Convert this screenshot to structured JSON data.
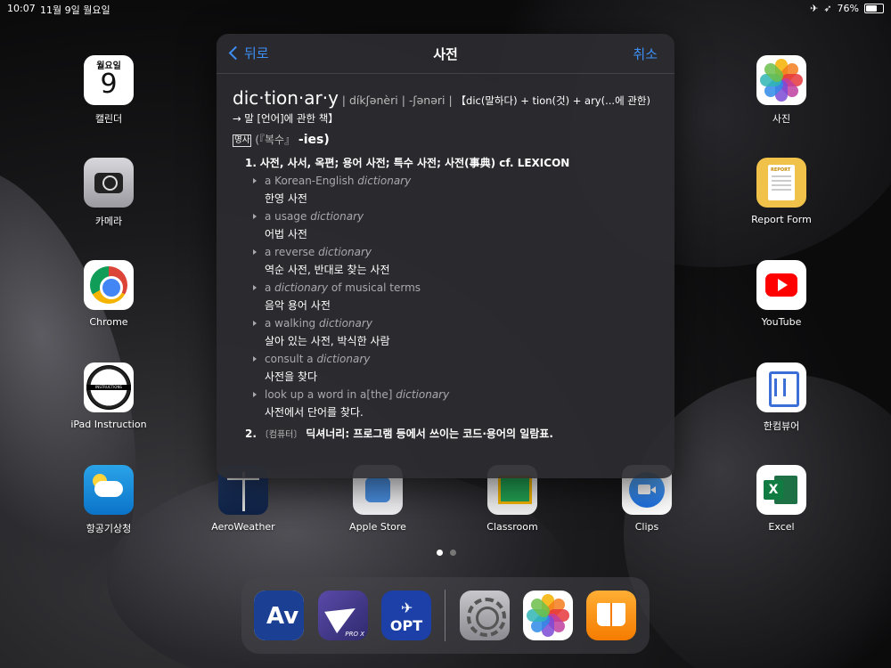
{
  "status_bar": {
    "time": "10:07",
    "date": "11월 9일 월요일",
    "battery": "76%",
    "battery_level": 0.76,
    "icons": [
      "airplane-icon",
      "location-icon"
    ]
  },
  "apps": {
    "calendar": {
      "label": "캘린더",
      "weekday": "월요일",
      "day": "9"
    },
    "camera": {
      "label": "카메라"
    },
    "chrome": {
      "label": "Chrome"
    },
    "ipad_instruction": {
      "label": "iPad Instruction",
      "logo_text": "INSTRUCTIONS"
    },
    "weather": {
      "label": "항공기상청"
    },
    "aeroweather": {
      "label": "AeroWeather"
    },
    "apple_store": {
      "label": "Apple Store"
    },
    "classroom": {
      "label": "Classroom"
    },
    "clips": {
      "label": "Clips"
    },
    "photos": {
      "label": "사진"
    },
    "report_form": {
      "label": "Report Form",
      "logo_text": "REPORT"
    },
    "youtube": {
      "label": "YouTube"
    },
    "hancom": {
      "label": "한컴뷰어"
    },
    "excel": {
      "label": "Excel",
      "logo_text": "X"
    }
  },
  "page_dots": {
    "count": 2,
    "active": 0
  },
  "dock": {
    "items": [
      {
        "name": "av-app",
        "text": "Av"
      },
      {
        "name": "flight-app",
        "text": "PRO X"
      },
      {
        "name": "opt-app",
        "text": "OPT"
      },
      {
        "name": "settings-app",
        "text": ""
      },
      {
        "name": "photos-app",
        "text": ""
      },
      {
        "name": "books-app",
        "text": ""
      }
    ]
  },
  "dictionary": {
    "back_label": "뒤로",
    "title": "사전",
    "cancel_label": "취소",
    "headword": "dic·tion·ar·y",
    "pronunciation": "| díkʃənèri | -ʃənəri |",
    "etymology": "【dic(말하다) + tion(것) + ary(...에 관한) → 말 [언어]에 관한 책】",
    "pos": "명사",
    "plural_prefix": "(『복수』",
    "plural_suffix": "-ies)",
    "senses": [
      {
        "num": "1.",
        "definition": "사전, 사서, 옥편; 용어 사전; 특수 사전; 사전(事典) cf. LEXICON",
        "examples": [
          {
            "pre": "a Korean-English ",
            "em": "dictionary",
            "post": "",
            "trans": "한영 사전"
          },
          {
            "pre": "a usage ",
            "em": "dictionary",
            "post": "",
            "trans": "어법 사전"
          },
          {
            "pre": "a reverse ",
            "em": "dictionary",
            "post": "",
            "trans": "역순 사전, 반대로 찾는 사전"
          },
          {
            "pre": "a ",
            "em": "dictionary",
            "post": " of musical terms",
            "trans": "음악 용어 사전"
          },
          {
            "pre": "a walking ",
            "em": "dictionary",
            "post": "",
            "trans": "살아 있는 사전, 박식한 사람"
          },
          {
            "pre": "consult a ",
            "em": "dictionary",
            "post": "",
            "trans": "사전을 찾다"
          },
          {
            "pre": "look up a word in a[the] ",
            "em": "dictionary",
            "post": "",
            "trans": "사전에서 단어를 찾다."
          }
        ]
      },
      {
        "num": "2.",
        "label": "〔컴퓨터〕",
        "definition": "딕셔너리: 프로그램 등에서 쓰이는 코드·용어의 일람표."
      }
    ]
  },
  "colors": {
    "accent": "#3d8ff5",
    "popup_bg": "#2c2c30"
  }
}
